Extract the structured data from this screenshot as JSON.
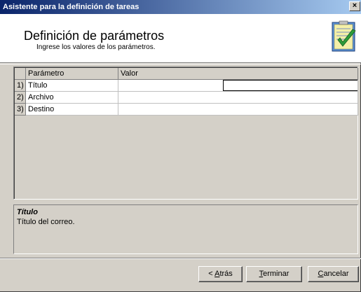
{
  "window": {
    "title": "Asistente para la definición de tareas",
    "close_glyph": "×"
  },
  "header": {
    "title": "Definición de parámetros",
    "subtitle": "Ingrese los valores de los parámetros.",
    "icon": "checklist-icon"
  },
  "grid": {
    "columns": [
      "",
      "Parámetro",
      "Valor"
    ],
    "rows": [
      {
        "index": "1)",
        "parametro": "Título",
        "valor": ""
      },
      {
        "index": "2)",
        "parametro": "Archivo",
        "valor": ""
      },
      {
        "index": "3)",
        "parametro": "Destino",
        "valor": ""
      }
    ]
  },
  "description": {
    "title": "Título",
    "text": "Título del correo."
  },
  "buttons": {
    "back_prefix": "< ",
    "back_key": "A",
    "back_rest": "trás",
    "finish_key": "T",
    "finish_rest": "erminar",
    "cancel_key": "C",
    "cancel_rest": "ancelar"
  },
  "colors": {
    "title_start": "#0a246a",
    "title_end": "#a6caf0",
    "face": "#d4d0c8",
    "check": "#2e9d3a"
  }
}
